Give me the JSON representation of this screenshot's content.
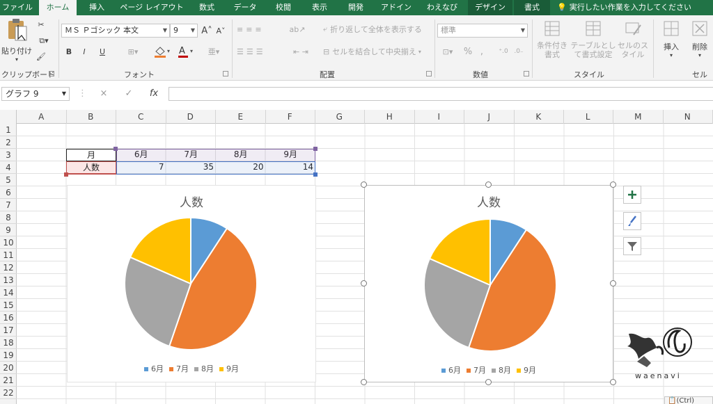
{
  "tabs": [
    "ファイル",
    "ホーム",
    "挿入",
    "ページ レイアウト",
    "数式",
    "データ",
    "校閲",
    "表示",
    "開発",
    "アドイン",
    "わえなび",
    "デザイン",
    "書式"
  ],
  "tell_me": "実行したい作業を入力してください",
  "ribbon": {
    "clipboard": {
      "paste_label": "貼り付け",
      "group_label": "クリップボード"
    },
    "font": {
      "font_name": "ＭＳ Ｐゴシック 本文",
      "font_size": "9",
      "group_label": "フォント",
      "bold": "B",
      "italic": "I",
      "underline": "U"
    },
    "alignment": {
      "wrap_text": "折り返して全体を表示する",
      "merge_center": "セルを結合して中央揃え",
      "group_label": "配置"
    },
    "number": {
      "format": "標準",
      "percent": "%",
      "comma": ",",
      "group_label": "数値"
    },
    "styles": {
      "conditional": "条件付き書式",
      "as_table": "テーブルとして書式設定",
      "cell_styles": "セルのスタイル",
      "group_label": "スタイル"
    },
    "cells": {
      "insert": "挿入",
      "delete": "削除",
      "group_label": "セル"
    }
  },
  "formula_bar": {
    "name_box": "グラフ 9",
    "cancel": "×",
    "enter": "✓",
    "fx": "fx"
  },
  "columns": [
    "A",
    "B",
    "C",
    "D",
    "E",
    "F",
    "G",
    "H",
    "I",
    "J",
    "K",
    "L",
    "M",
    "N"
  ],
  "rows": [
    "1",
    "2",
    "3",
    "4",
    "5",
    "6",
    "7",
    "8",
    "9",
    "10",
    "11",
    "12",
    "13",
    "14",
    "15",
    "16",
    "17",
    "18",
    "19",
    "20",
    "21",
    "22"
  ],
  "table": {
    "header_label": "月",
    "value_label": "人数",
    "months": [
      "6月",
      "7月",
      "8月",
      "9月"
    ],
    "counts": [
      "7",
      "35",
      "20",
      "14"
    ]
  },
  "chart_data": [
    {
      "type": "pie",
      "title": "人数",
      "categories": [
        "6月",
        "7月",
        "8月",
        "9月"
      ],
      "values": [
        7,
        35,
        20,
        14
      ],
      "colors": [
        "#5b9bd5",
        "#ed7d31",
        "#a5a5a5",
        "#ffc000"
      ],
      "legend": "bottom"
    },
    {
      "type": "pie",
      "title": "人数",
      "categories": [
        "6月",
        "7月",
        "8月",
        "9月"
      ],
      "values": [
        7,
        35,
        20,
        14
      ],
      "colors": [
        "#5b9bd5",
        "#ed7d31",
        "#a5a5a5",
        "#ffc000"
      ],
      "legend": "bottom"
    }
  ],
  "watermark": "waenavi",
  "paste_options": "(Ctrl)"
}
